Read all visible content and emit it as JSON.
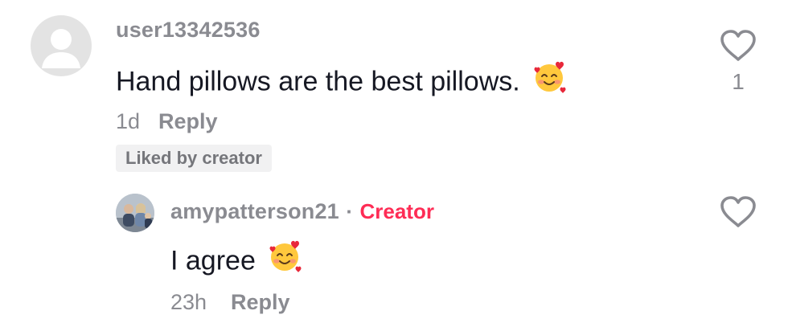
{
  "colors": {
    "muted": "#8a8b91",
    "text": "#161823",
    "creator": "#fe2c55",
    "badge_bg": "#f1f1f2"
  },
  "comment": {
    "username": "user13342536",
    "text": "Hand pillows are the best pillows.",
    "emoji": "smiling-face-with-hearts",
    "age": "1d",
    "reply_label": "Reply",
    "liked_badge": "Liked by creator",
    "like_count": "1"
  },
  "reply": {
    "username": "amypatterson21",
    "separator": "·",
    "creator_label": "Creator",
    "text": "I agree",
    "emoji": "smiling-face-with-hearts",
    "age": "23h",
    "reply_label": "Reply"
  },
  "icons": {
    "like": "heart-outline-icon",
    "avatar_placeholder": "user-silhouette-icon"
  }
}
